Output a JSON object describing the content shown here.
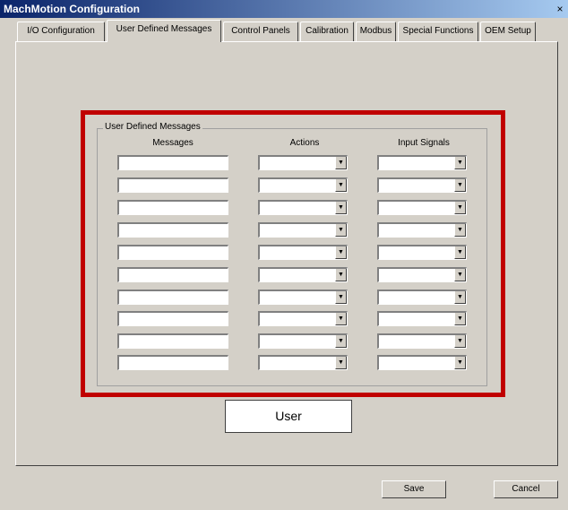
{
  "window": {
    "title": "MachMotion Configuration",
    "close_glyph": "×"
  },
  "tabs": [
    {
      "label": "I/O Configuration"
    },
    {
      "label": "User Defined Messages",
      "active": true
    },
    {
      "label": "Control Panels"
    },
    {
      "label": "Calibration"
    },
    {
      "label": "Modbus"
    },
    {
      "label": "Special Functions"
    },
    {
      "label": "OEM Setup"
    }
  ],
  "group": {
    "legend": "User Defined Messages",
    "columns": {
      "messages": "Messages",
      "actions": "Actions",
      "input_signals": "Input Signals"
    }
  },
  "rows": [
    {
      "message": "",
      "action": "",
      "input_signal": ""
    },
    {
      "message": "",
      "action": "",
      "input_signal": ""
    },
    {
      "message": "",
      "action": "",
      "input_signal": ""
    },
    {
      "message": "",
      "action": "",
      "input_signal": ""
    },
    {
      "message": "",
      "action": "",
      "input_signal": ""
    },
    {
      "message": "",
      "action": "",
      "input_signal": ""
    },
    {
      "message": "",
      "action": "",
      "input_signal": ""
    },
    {
      "message": "",
      "action": "",
      "input_signal": ""
    },
    {
      "message": "",
      "action": "",
      "input_signal": ""
    },
    {
      "message": "",
      "action": "",
      "input_signal": ""
    }
  ],
  "dropdown_glyph": "▼",
  "callout": {
    "label": "User"
  },
  "buttons": {
    "save": "Save",
    "cancel": "Cancel"
  },
  "colors": {
    "highlight": "#c00000",
    "dialog_bg": "#d4d0c8"
  }
}
